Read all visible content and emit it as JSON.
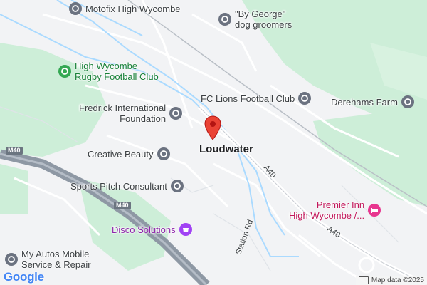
{
  "map": {
    "town_label": "Loudwater",
    "roads": {
      "m40_a": "M40",
      "m40_b": "M40",
      "a40_a": "A40",
      "a40_b": "A40",
      "station_rd": "Station Rd"
    },
    "pois": [
      {
        "label": "Motofix High Wycombe",
        "type": "grey"
      },
      {
        "label": "\"By George\"\ndog groomers",
        "type": "grey"
      },
      {
        "label": "High Wycombe\nRugby Football Club",
        "type": "green"
      },
      {
        "label": "FC Lions Football Club",
        "type": "grey"
      },
      {
        "label": "Derehams Farm",
        "type": "grey"
      },
      {
        "label": "Fredrick International\nFoundation",
        "type": "grey"
      },
      {
        "label": "Creative Beauty",
        "type": "grey"
      },
      {
        "label": "Sports Pitch Consultant",
        "type": "grey"
      },
      {
        "label": "Premier Inn\nHigh Wycombe /...",
        "type": "pink"
      },
      {
        "label": "Disco Solutions",
        "type": "purple"
      },
      {
        "label": "My Autos Mobile\nService & Repair",
        "type": "grey"
      }
    ],
    "colors": {
      "land": "#f2f3f5",
      "park": "#cdeed8",
      "river": "#aadaff",
      "motorway": "#8e98a4",
      "road": "#ffffff",
      "marker": "#ea4335"
    }
  },
  "footer": {
    "logo": "Google",
    "attribution": "Map data ©2025"
  }
}
